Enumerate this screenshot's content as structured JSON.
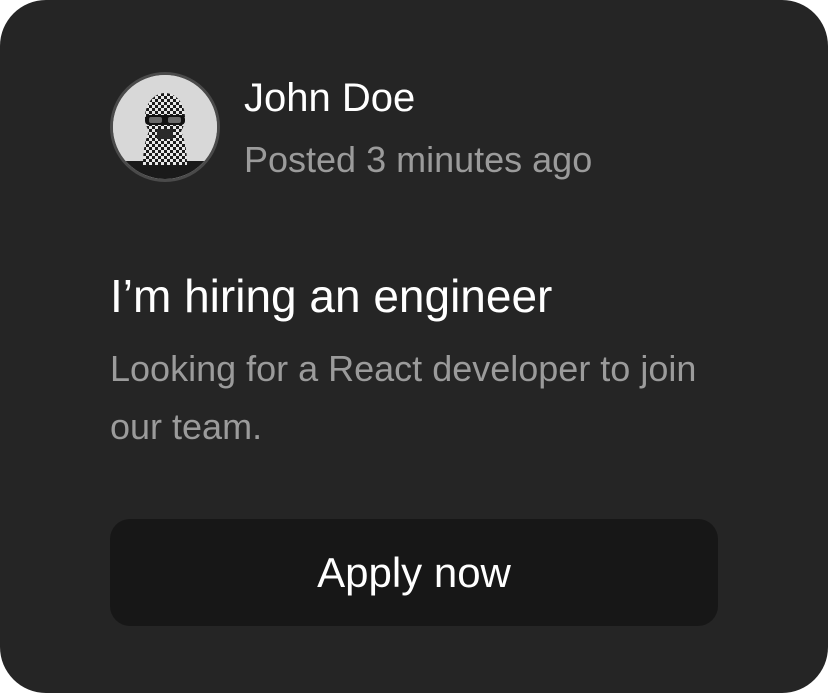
{
  "author": {
    "name": "John Doe",
    "posted": "Posted 3 minutes ago",
    "avatar_icon": "user-avatar-photo"
  },
  "post": {
    "title": "I’m hiring an engineer",
    "body": "Looking for a React developer to join our team."
  },
  "actions": {
    "apply_label": "Apply now"
  },
  "colors": {
    "card_background": "#252525",
    "button_background": "#171717",
    "primary_text": "#ffffff",
    "secondary_text": "#9b9b9b"
  }
}
